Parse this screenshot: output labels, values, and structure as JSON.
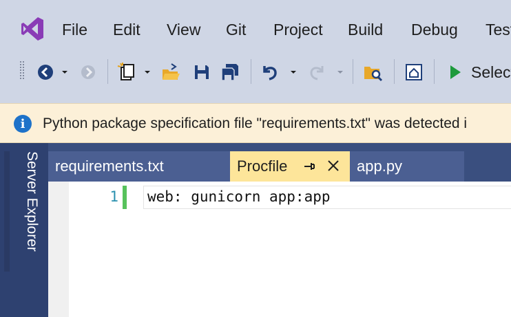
{
  "menu": {
    "items": [
      "File",
      "Edit",
      "View",
      "Git",
      "Project",
      "Build",
      "Debug",
      "Test"
    ]
  },
  "toolbar": {
    "icons": [
      "back-icon",
      "forward-icon",
      "new-project-icon",
      "open-folder-icon",
      "save-icon",
      "save-all-icon",
      "undo-icon",
      "redo-icon",
      "find-in-files-icon",
      "solution-explorer-icon",
      "start-icon"
    ],
    "start_label": "Select"
  },
  "infobar": {
    "message": "Python package specification file \"requirements.txt\" was detected i"
  },
  "sidebar": {
    "server_explorer_label": "Server Explorer"
  },
  "tabs": [
    {
      "label": "requirements.txt",
      "active": false
    },
    {
      "label": "Procfile",
      "active": true
    },
    {
      "label": "app.py",
      "active": false
    }
  ],
  "editor": {
    "line_number": "1",
    "code": "web: gunicorn app:app"
  },
  "colors": {
    "accent": "#68217a",
    "chrome": "#cfd6e5",
    "active_tab": "#fde59a",
    "info": "#1e72c9",
    "change_mark": "#57c25c"
  }
}
